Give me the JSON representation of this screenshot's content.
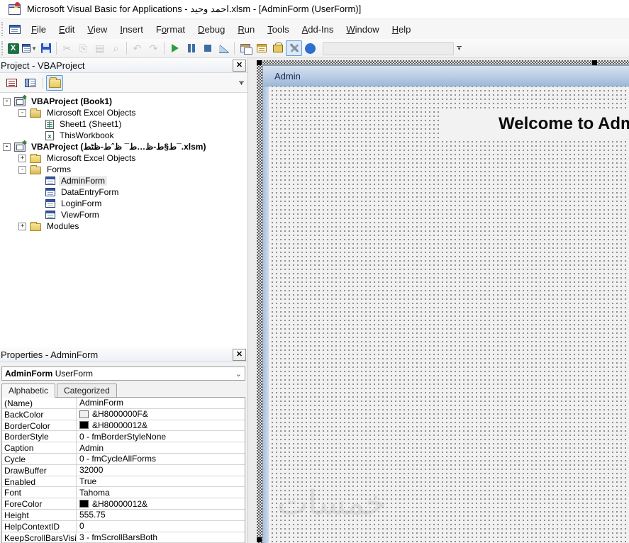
{
  "window": {
    "title": "Microsoft Visual Basic for Applications - احمد وحيد.xlsm - [AdminForm (UserForm)]"
  },
  "menu": {
    "items": [
      {
        "label": "File",
        "accel": 0
      },
      {
        "label": "Edit",
        "accel": 0
      },
      {
        "label": "View",
        "accel": 0
      },
      {
        "label": "Insert",
        "accel": 0
      },
      {
        "label": "Format",
        "accel": 1
      },
      {
        "label": "Debug",
        "accel": 0
      },
      {
        "label": "Run",
        "accel": 0
      },
      {
        "label": "Tools",
        "accel": 0
      },
      {
        "label": "Add-Ins",
        "accel": 0
      },
      {
        "label": "Window",
        "accel": 0
      },
      {
        "label": "Help",
        "accel": 0
      }
    ]
  },
  "toolbar": {
    "buttons": [
      {
        "name": "view-microsoft-excel",
        "kind": "excel",
        "disabled": false,
        "active": false,
        "dropdown": false
      },
      {
        "name": "insert-userform",
        "kind": "formico",
        "disabled": false,
        "active": false,
        "dropdown": true
      },
      {
        "name": "save",
        "kind": "save",
        "disabled": false,
        "active": false,
        "dropdown": false
      },
      {
        "name": "sep"
      },
      {
        "name": "cut",
        "kind": "txt",
        "glyph": "✂",
        "disabled": true
      },
      {
        "name": "copy",
        "kind": "txt",
        "glyph": "⎘",
        "disabled": true
      },
      {
        "name": "paste",
        "kind": "txt",
        "glyph": "▤",
        "disabled": true
      },
      {
        "name": "find",
        "kind": "txt",
        "glyph": "⌕",
        "disabled": true
      },
      {
        "name": "sep"
      },
      {
        "name": "undo",
        "kind": "txt",
        "glyph": "↶",
        "disabled": true
      },
      {
        "name": "redo",
        "kind": "txt",
        "glyph": "↷",
        "disabled": true
      },
      {
        "name": "sep"
      },
      {
        "name": "run-sub-userform",
        "kind": "run",
        "disabled": false
      },
      {
        "name": "break",
        "kind": "break",
        "disabled": false
      },
      {
        "name": "reset",
        "kind": "reset",
        "disabled": false
      },
      {
        "name": "design-mode",
        "kind": "design",
        "disabled": false
      },
      {
        "name": "sep"
      },
      {
        "name": "project-explorer",
        "kind": "projexp",
        "disabled": false
      },
      {
        "name": "properties-window",
        "kind": "propwin",
        "disabled": false
      },
      {
        "name": "object-browser",
        "kind": "objbrow",
        "disabled": false
      },
      {
        "name": "toolbox",
        "kind": "toolbox",
        "disabled": false,
        "active": true
      },
      {
        "name": "help",
        "kind": "help",
        "disabled": false
      }
    ],
    "combo_value": ""
  },
  "project_panel": {
    "title": "Project - VBAProject",
    "tree": [
      {
        "label": "VBAProject (Book1)",
        "bold": true,
        "level": 0,
        "expander": "-",
        "icon": "project"
      },
      {
        "label": "Microsoft Excel Objects",
        "bold": false,
        "level": 1,
        "expander": "-",
        "icon": "folder-open"
      },
      {
        "label": "Sheet1 (Sheet1)",
        "bold": false,
        "level": 2,
        "expander": "",
        "icon": "sheet"
      },
      {
        "label": "ThisWorkbook",
        "bold": false,
        "level": 2,
        "expander": "",
        "icon": "workbook"
      },
      {
        "label": "VBAProject (ط§ط-ظ…ط¯ ظˆط-ظٹط¯.xlsm)",
        "bold": true,
        "level": 0,
        "expander": "-",
        "icon": "project"
      },
      {
        "label": "Microsoft Excel Objects",
        "bold": false,
        "level": 1,
        "expander": "+",
        "icon": "folder"
      },
      {
        "label": "Forms",
        "bold": false,
        "level": 1,
        "expander": "-",
        "icon": "folder-open"
      },
      {
        "label": "AdminForm",
        "bold": false,
        "level": 2,
        "expander": "",
        "icon": "form",
        "selected": true
      },
      {
        "label": "DataEntryForm",
        "bold": false,
        "level": 2,
        "expander": "",
        "icon": "form"
      },
      {
        "label": "LoginForm",
        "bold": false,
        "level": 2,
        "expander": "",
        "icon": "form"
      },
      {
        "label": "ViewForm",
        "bold": false,
        "level": 2,
        "expander": "",
        "icon": "form"
      },
      {
        "label": "Modules",
        "bold": false,
        "level": 1,
        "expander": "+",
        "icon": "folder"
      }
    ]
  },
  "properties_panel": {
    "title": "Properties - AdminForm",
    "object_name": "AdminForm",
    "object_type": "UserForm",
    "tabs": [
      "Alphabetic",
      "Categorized"
    ],
    "active_tab": "Alphabetic",
    "rows": [
      {
        "prop": "(Name)",
        "value": "AdminForm"
      },
      {
        "prop": "BackColor",
        "value": "&H8000000F&",
        "swatch": "#f0f0f0"
      },
      {
        "prop": "BorderColor",
        "value": "&H80000012&",
        "swatch": "#000000"
      },
      {
        "prop": "BorderStyle",
        "value": "0 - fmBorderStyleNone"
      },
      {
        "prop": "Caption",
        "value": "Admin"
      },
      {
        "prop": "Cycle",
        "value": "0 - fmCycleAllForms"
      },
      {
        "prop": "DrawBuffer",
        "value": "32000"
      },
      {
        "prop": "Enabled",
        "value": "True"
      },
      {
        "prop": "Font",
        "value": "Tahoma"
      },
      {
        "prop": "ForeColor",
        "value": "&H80000012&",
        "swatch": "#000000"
      },
      {
        "prop": "Height",
        "value": "555.75"
      },
      {
        "prop": "HelpContextID",
        "value": "0"
      },
      {
        "prop": "KeepScrollBarsVisible",
        "value": "3 - fmScrollBarsBoth"
      }
    ]
  },
  "designer": {
    "form_caption": "Admin",
    "welcome_label": "Welcome to Admin",
    "watermark": "خمسات"
  },
  "colors": {
    "form_titlebar_top": "#d6e1ef",
    "form_titlebar_bottom": "#9db9d9",
    "form_background": "#f1f1f1",
    "toolbox_active_border": "#5e9ad6",
    "run_green": "#2f9c41",
    "debug_blue": "#3a6ea5"
  }
}
